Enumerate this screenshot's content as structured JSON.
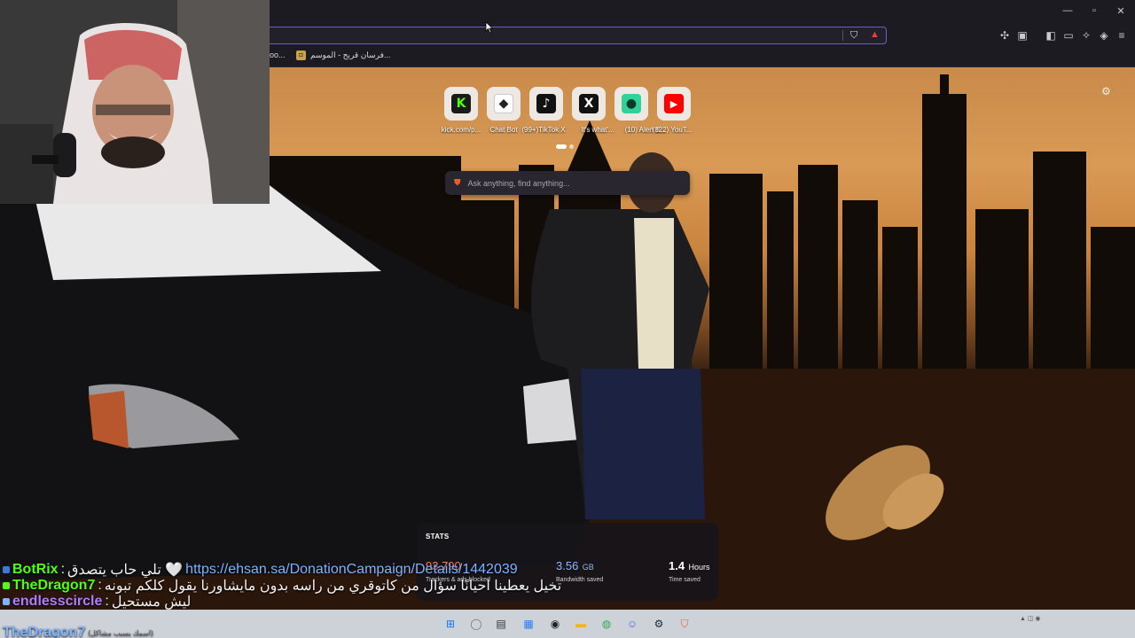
{
  "browser": {
    "bookmarks": [
      {
        "label": "oo..."
      },
      {
        "label": "فرسان قريح - الموسم..."
      }
    ]
  },
  "new_tab": {
    "top_sites": [
      {
        "label": "kick.com/p...",
        "icon": "kick-icon",
        "glyph": "K",
        "bg": "#1a1a1a",
        "fg": "#53fc18"
      },
      {
        "label": "Chat Bot",
        "icon": "chat-bot-icon",
        "glyph": "◆",
        "bg": "#ffffff",
        "fg": "#222222"
      },
      {
        "label": "(99+)TikTok X",
        "icon": "tiktok-icon",
        "glyph": "♪",
        "bg": "#111111",
        "fg": "#ffffff"
      },
      {
        "label": "It's what'...",
        "icon": "x-icon",
        "glyph": "X",
        "bg": "#111111",
        "fg": "#ffffff"
      },
      {
        "label": "(10) Alert B...",
        "icon": "alert-box-icon",
        "glyph": "●",
        "bg": "#2fd39a",
        "fg": "#0e3a2a"
      },
      {
        "label": "(822) YouT...",
        "icon": "youtube-icon",
        "glyph": "▶",
        "bg": "#ff0000",
        "fg": "#ffffff"
      }
    ],
    "search_placeholder": "Ask anything, find anything...",
    "stats": {
      "title": "STATS",
      "trackers_value": "93,790",
      "trackers_label": "Trackers & ads blocked",
      "bandwidth_value": "3.56",
      "bandwidth_unit": "GB",
      "bandwidth_label": "Bandwidth saved",
      "time_value": "1.4",
      "time_unit": "Hours",
      "time_label": "Time saved"
    }
  },
  "chat": [
    {
      "user": "BotRix",
      "user_color": "#53fc18",
      "message": "تلي حاب يتصدق 🤍",
      "link": "https://ehsan.sa/DonationCampaign/Details/1442039"
    },
    {
      "user": "TheDragon7",
      "user_color": "#53fc18",
      "message": "تخيل يعطينا احيانًا سؤال من كاتوقري من راسه بدون مايشاورنا يقول كلكم تبونه"
    },
    {
      "user": "endlesscircle",
      "user_color": "#b07cff",
      "message": "ليش مستحيل"
    },
    {
      "user": "TheDragon7",
      "user_color": "#53fc18",
      "message": "(اسمك يسبب مشاكل)"
    }
  ],
  "colors": {
    "accent": "#6d5bd6",
    "trackers": "#ff7a5c",
    "bandwidth": "#8fb6ff",
    "time": "#ffffff"
  }
}
